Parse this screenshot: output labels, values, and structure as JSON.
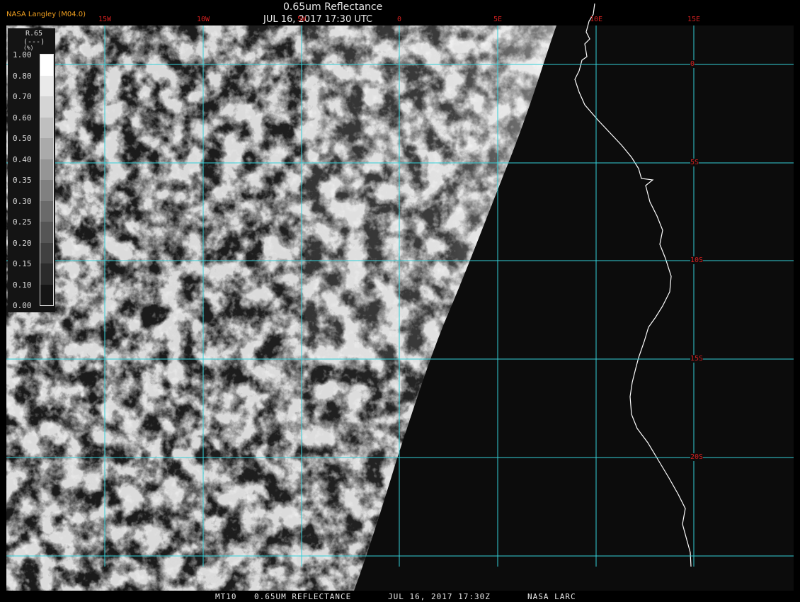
{
  "header": {
    "agency": "NASA Langley (M04.0)",
    "title": "0.65um Reflectance",
    "datetime": "JUL 16, 2017 17:30 UTC"
  },
  "longitude_labels": [
    "15W",
    "10W",
    "5W",
    "0",
    "5E",
    "10E",
    "15E"
  ],
  "latitude_labels": [
    "0",
    "5S",
    "10S",
    "15S",
    "20S"
  ],
  "legend": {
    "product": "R.65",
    "units": "(---)",
    "unit_symbol": "(%)",
    "ticks": [
      "1.00",
      "0.80",
      "0.70",
      "0.60",
      "0.50",
      "0.40",
      "0.35",
      "0.30",
      "0.25",
      "0.20",
      "0.15",
      "0.10",
      "0.00"
    ]
  },
  "footer": {
    "satellite": "MT10",
    "product": "0.65UM REFLECTANCE",
    "datetime": "JUL 16, 2017 17:30Z",
    "source": "NASA LARC"
  },
  "colors": {
    "gridline": "#34d0d8",
    "grid_label": "#d22020",
    "coastline": "#ffffff",
    "agency": "#f0a020",
    "background": "#0c0c0c"
  }
}
